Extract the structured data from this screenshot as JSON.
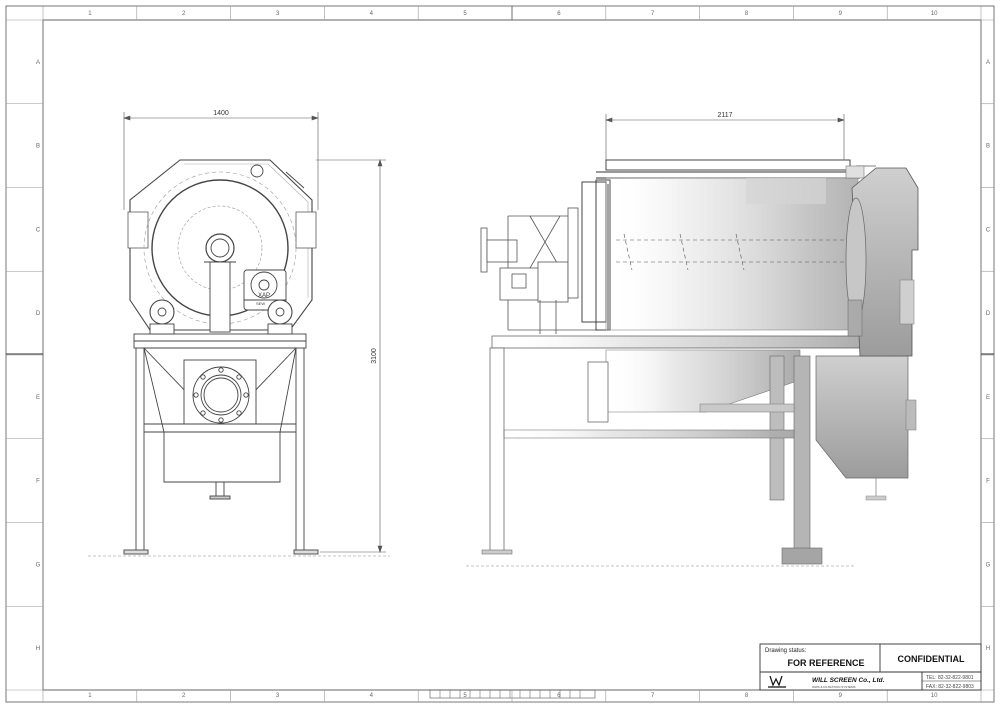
{
  "sheet": {
    "column_labels": [
      "1",
      "2",
      "3",
      "4",
      "5",
      "6",
      "7",
      "8",
      "9",
      "10"
    ],
    "row_labels": [
      "A",
      "B",
      "C",
      "D",
      "E",
      "F",
      "G",
      "H"
    ]
  },
  "dimensions": {
    "front_width": "1400",
    "front_height": "3100",
    "side_width": "2117"
  },
  "front_view": {
    "motor_plate_line1": "XAP",
    "motor_plate_line2": "SEW"
  },
  "title_block": {
    "status_label": "Drawing status:",
    "status_value": "FOR REFERENCE",
    "classification": "CONFIDENTIAL",
    "company": "WILL SCREEN Co., Ltd.",
    "company_tagline": "WWS & FILTRATION SYSTEMS",
    "tel": "TEL: 82-32-822-9801",
    "fax": "FAX: 82-32-822-9803"
  },
  "colors": {
    "line": "#555555",
    "frame": "#333333",
    "steel": "#b8b8b8"
  }
}
